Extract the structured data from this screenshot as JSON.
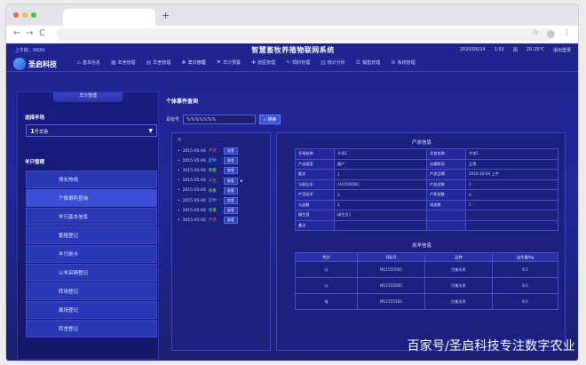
{
  "browser": {
    "new_tab_symbol": "+",
    "back": "←",
    "forward": "→",
    "reload": "C",
    "star": "☆",
    "menu": "⋮"
  },
  "app": {
    "top_left": "上午好，XXXX",
    "title": "智慧畜牧养殖物联网系统",
    "date": "2020/06/24",
    "time": "1:02",
    "weather": "阴",
    "temp": "20-25℃",
    "logout": "退出登录"
  },
  "logo": "圣启科技",
  "nav": [
    {
      "icon": "⌂",
      "label": "基本信息"
    },
    {
      "icon": "▦",
      "label": "羊舍管理"
    },
    {
      "icon": "▤",
      "label": "羊舍管理"
    },
    {
      "icon": "♣",
      "label": "羊只管理"
    },
    {
      "icon": "⚑",
      "label": "羊只预警"
    },
    {
      "icon": "✚",
      "label": "兽医管理"
    },
    {
      "icon": "✎",
      "label": "饲料管理"
    },
    {
      "icon": "▥",
      "label": "统计分析"
    },
    {
      "icon": "☰",
      "label": "销售管理"
    },
    {
      "icon": "⚙",
      "label": "系统管理"
    }
  ],
  "sidebar": {
    "title": "羊只管理",
    "pick_label": "选择羊场",
    "select_num": "1",
    "select_text": "号羊场",
    "section": "羊只管理",
    "items": [
      "场长热线",
      "个体事件查询",
      "羊只基本信息",
      "繁殖登记",
      "羊只刷卡",
      "公羊采精登记",
      "转场登记",
      "离场登记",
      "转舍登记"
    ]
  },
  "content": {
    "title": "个体事件查询",
    "ear_label": "耳标号",
    "ear_value": "%%%%%%%",
    "search_btn": "搜索"
  },
  "events": [
    {
      "date": "2015-05-04",
      "tag": "产羔",
      "tag_color": "#ff6b6b",
      "btn": "查看"
    },
    {
      "date": "2015-05-04",
      "tag": "配种",
      "tag_color": "#4fb0ff",
      "btn": "查看"
    },
    {
      "date": "2015-05-04",
      "tag": "称重",
      "tag_color": "#7ee06a",
      "btn": "查看"
    },
    {
      "date": "2015-05-04",
      "tag": "产羔",
      "tag_color": "#ff6b6b",
      "btn": "查看"
    },
    {
      "date": "2015-05-04",
      "tag": "称重",
      "tag_color": "#7ee06a",
      "btn": "查看"
    },
    {
      "date": "2015-05-04",
      "tag": "配种",
      "tag_color": "#4fb0ff",
      "btn": "查看"
    },
    {
      "date": "2015-05-04",
      "tag": "称重",
      "tag_color": "#7ee06a",
      "btn": "查看"
    },
    {
      "date": "2015-05-04",
      "tag": "产羔",
      "tag_color": "#ff6b6b",
      "btn": "查看"
    }
  ],
  "birth_info": {
    "title": "产羔信息",
    "rows": [
      [
        "羊场名称",
        "羊场1",
        "羊舍名称",
        "羊舍1"
      ],
      [
        "产羔类型",
        "顺产",
        "分娩状况",
        "正常"
      ],
      [
        "胎次",
        "1",
        "产羔日期",
        "2016-10-04 上午"
      ],
      [
        "与配公羊",
        "CH1508181",
        "产羔总数",
        "1"
      ],
      [
        "产活羔羊",
        "3",
        "产死羔数",
        "0"
      ],
      [
        "公羔数",
        "2",
        "母羔数",
        "1"
      ],
      [
        "接生员",
        "接生员1",
        "",
        ""
      ],
      [
        "备注",
        "",
        "",
        ""
      ]
    ]
  },
  "lamb_info": {
    "title": "羔羊信息",
    "headers": [
      "性别",
      "耳标号",
      "品种",
      "出生重/kg"
    ],
    "rows": [
      [
        "公",
        "M11555565",
        "巴美羊系",
        "8.5"
      ],
      [
        "公",
        "M11555565",
        "巴美羊系",
        "8.5"
      ],
      [
        "母",
        "M11555565",
        "巴美羊系",
        "8.5"
      ]
    ]
  },
  "watermark": "百家号/圣启科技专注数字农业"
}
